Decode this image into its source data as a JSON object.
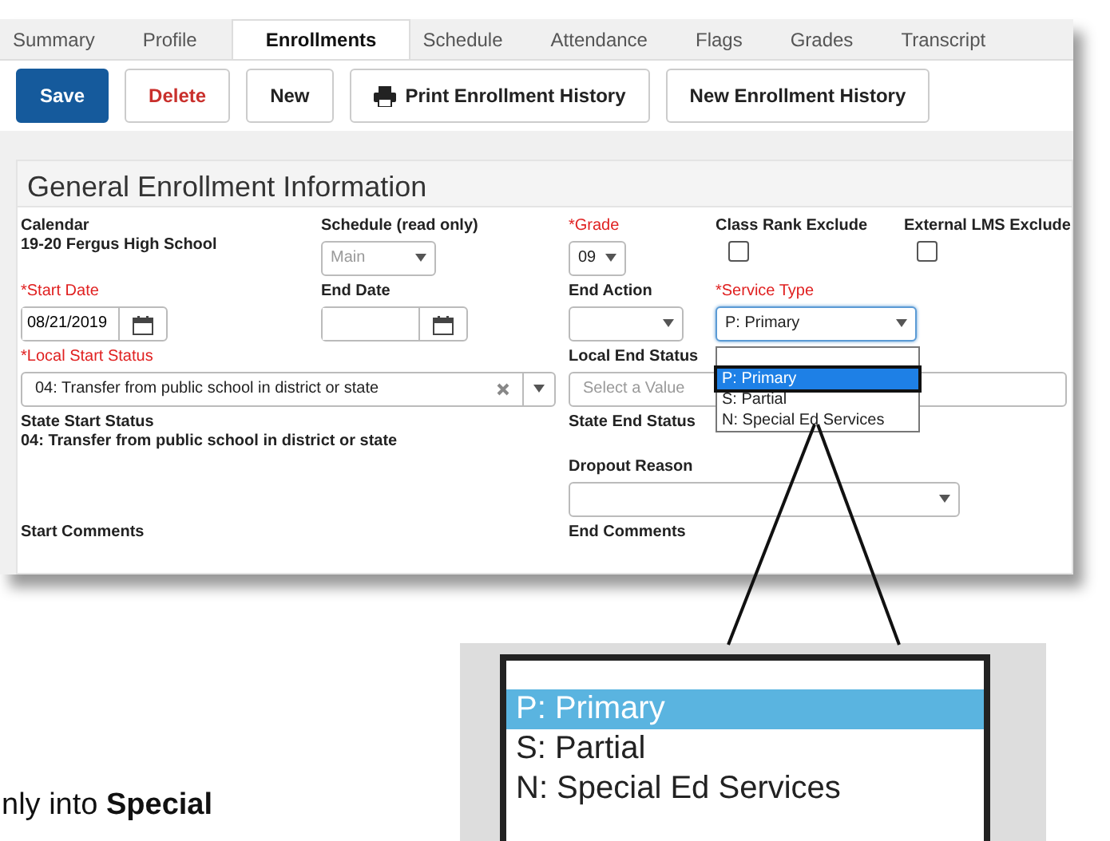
{
  "tabs": [
    {
      "label": "Summary",
      "selected": false
    },
    {
      "label": "Profile",
      "selected": false
    },
    {
      "label": "Enrollments",
      "selected": true
    },
    {
      "label": "Schedule",
      "selected": false
    },
    {
      "label": "Attendance",
      "selected": false
    },
    {
      "label": "Flags",
      "selected": false
    },
    {
      "label": "Grades",
      "selected": false
    },
    {
      "label": "Transcript",
      "selected": false
    }
  ],
  "toolbar": [
    {
      "label": "Save",
      "kind": "primary"
    },
    {
      "label": "Delete",
      "kind": "danger"
    },
    {
      "label": "New",
      "kind": "plain"
    },
    {
      "label": "Print Enrollment History",
      "kind": "print"
    },
    {
      "label": "New Enrollment History",
      "kind": "plain"
    }
  ],
  "section": {
    "title": "General Enrollment Information",
    "rows": [
      [
        {
          "kind": "static",
          "label": "Calendar",
          "value": "19-20 Fergus High School"
        },
        {
          "kind": "select",
          "label": "Schedule (read only)",
          "value": "Main",
          "disabled": true
        },
        {
          "kind": "select",
          "label": "*Grade",
          "required": true,
          "value": "09"
        },
        {
          "kind": "checkbox",
          "label": "Class Rank Exclude",
          "checked": false
        },
        {
          "kind": "checkbox",
          "label": "External LMS Exclude",
          "checked": false
        }
      ],
      [
        {
          "kind": "date",
          "label": "*Start Date",
          "required": true,
          "value": "08/21/2019"
        },
        {
          "kind": "date",
          "label": "End Date"
        },
        {
          "kind": "select",
          "label": "End Action"
        },
        {
          "kind": "select",
          "label": "*Service Type",
          "required": true,
          "value": "P: Primary",
          "open": true,
          "options": [
            {
              "label": "P: Primary",
              "selected": true
            },
            {
              "label": "S: Partial",
              "selected": false
            },
            {
              "label": "N: Special Ed Services",
              "selected": false
            }
          ]
        }
      ],
      [
        {
          "kind": "combo",
          "label": "*Local Start Status",
          "required": true,
          "value": "04: Transfer from public school in district or state"
        },
        {
          "kind": "combo",
          "label": "Local End Status",
          "placeholder": "Select a Value"
        }
      ],
      [
        {
          "kind": "static",
          "label": "State Start Status",
          "value": "04: Transfer from public school in district or state"
        },
        {
          "kind": "static",
          "label": "State End Status"
        }
      ],
      [
        "",
        {
          "kind": "select",
          "label": "Dropout Reason"
        }
      ],
      [
        {
          "kind": "static",
          "label": "Start Comments"
        },
        {
          "kind": "static",
          "label": "End Comments"
        }
      ]
    ]
  },
  "callout": {
    "options": [
      {
        "label": "P: Primary",
        "selected": true
      },
      {
        "label": "S: Partial",
        "selected": false
      },
      {
        "label": "N: Special Ed Services",
        "selected": false
      }
    ]
  },
  "caption": "nly into **Special**"
}
